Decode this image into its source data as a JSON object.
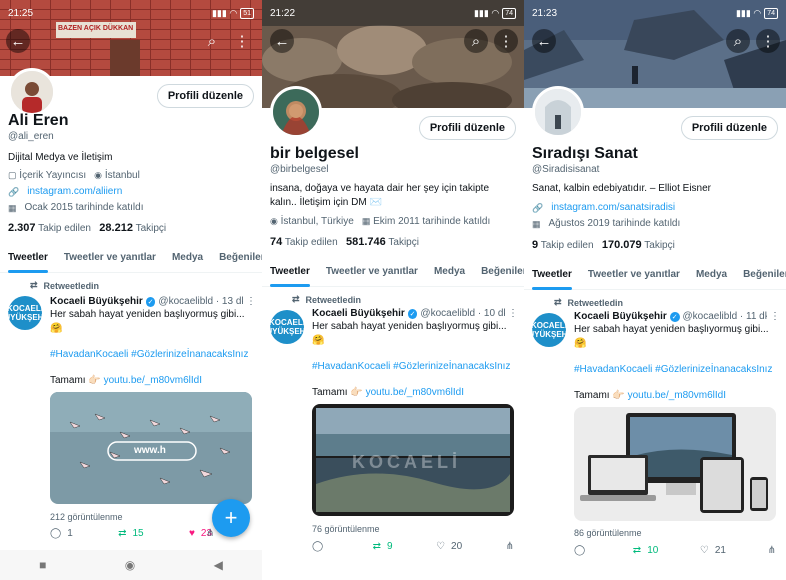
{
  "panels": [
    {
      "status": {
        "time": "21:25",
        "battery": "51"
      },
      "profile": {
        "name": "Ali Eren",
        "handle": "@ali_eren",
        "bio": "Dijital Medya ve İletişim",
        "category": "İçerik Yayıncısı",
        "location": "İstanbul",
        "website": "instagram.com/aliiern",
        "joined": "Ocak 2015 tarihinde katıldı",
        "following_count": "2.307",
        "following_label": "Takip edilen",
        "followers_count": "28.212",
        "followers_label": "Takipçi",
        "banner_text": "BAZEN AÇIK DÜKKAN"
      },
      "edit_label": "Profili düzenle",
      "tabs": [
        "Tweetler",
        "Tweetler ve yanıtlar",
        "Medya",
        "Beğeniler"
      ],
      "tweet": {
        "retweet_label": "Retweetledin",
        "author": "Kocaeli Büyükşehir",
        "meta": "@kocaelibld · 13 dk",
        "line1": "Her sabah hayat yeniden başlıyormuş gibi...",
        "emoji": "🤗",
        "hashtags": "#HavadanKocaeli #GözlerinizeİnanacaksInız",
        "link_prefix": "Tamamı 👉🏻",
        "link": "youtu.be/_m80vm6lIdI",
        "media_text": "www.h",
        "views": "212 görüntülenme",
        "replies": "1",
        "retweets": "15",
        "likes": "23"
      }
    },
    {
      "status": {
        "time": "21:22",
        "battery": "74"
      },
      "profile": {
        "name": "bir belgesel",
        "handle": "@birbelgesel",
        "bio": "insana, doğaya ve hayata dair her şey için takipte kalın.. İletişim için DM ✉️",
        "location": "İstanbul, Türkiye",
        "joined": "Ekim 2011 tarihinde katıldı",
        "following_count": "74",
        "following_label": "Takip edilen",
        "followers_count": "581.746",
        "followers_label": "Takipçi"
      },
      "edit_label": "Profili düzenle",
      "tabs": [
        "Tweetler",
        "Tweetler ve yanıtlar",
        "Medya",
        "Beğeniler"
      ],
      "tweet": {
        "retweet_label": "Retweetledin",
        "author": "Kocaeli Büyükşehir",
        "meta": "@kocaelibld · 10 dk",
        "line1": "Her sabah hayat yeniden başlıyormuş gibi...",
        "emoji": "🤗",
        "hashtags": "#HavadanKocaeli #GözlerinizeİnanacaksInız",
        "link_prefix": "Tamamı 👉🏻",
        "link": "youtu.be/_m80vm6lIdI",
        "media_text": "KOCAELİ",
        "views": "76 görüntülenme",
        "replies": "",
        "retweets": "9",
        "likes": "20"
      }
    },
    {
      "status": {
        "time": "21:23",
        "battery": "74"
      },
      "profile": {
        "name": "Sıradışı Sanat",
        "handle": "@Siradisisanat",
        "bio": "Sanat, kalbin edebiyatıdır. – Elliot Eisner",
        "website": "instagram.com/sanatsiradisi",
        "joined": "Ağustos 2019 tarihinde katıldı",
        "following_count": "9",
        "following_label": "Takip edilen",
        "followers_count": "170.079",
        "followers_label": "Takipçi"
      },
      "edit_label": "Profili düzenle",
      "tabs": [
        "Tweetler",
        "Tweetler ve yanıtlar",
        "Medya",
        "Beğeniler"
      ],
      "tweet": {
        "retweet_label": "Retweetledin",
        "author": "Kocaeli Büyükşehir",
        "meta": "@kocaelibld · 11 dk",
        "line1": "Her sabah hayat yeniden başlıyormuş gibi...",
        "emoji": "🤗",
        "hashtags": "#HavadanKocaeli #GözlerinizeİnanacaksInız",
        "link_prefix": "Tamamı 👉🏻",
        "link": "youtu.be/_m80vm6lIdI",
        "views": "86 görüntülenme",
        "replies": "",
        "retweets": "10",
        "likes": "21"
      }
    }
  ],
  "avatar_brand": "KOCAELİ BÜYÜKŞEHİR",
  "colors": {
    "accent": "#1d9bf0",
    "retweet": "#00ba7c",
    "like": "#f91880"
  },
  "icons": [
    "back-arrow-icon",
    "search-icon",
    "more-vertical-icon",
    "location-icon",
    "link-icon",
    "calendar-icon",
    "retweet-icon",
    "reply-icon",
    "like-icon",
    "share-icon",
    "compose-icon",
    "verified-icon"
  ]
}
